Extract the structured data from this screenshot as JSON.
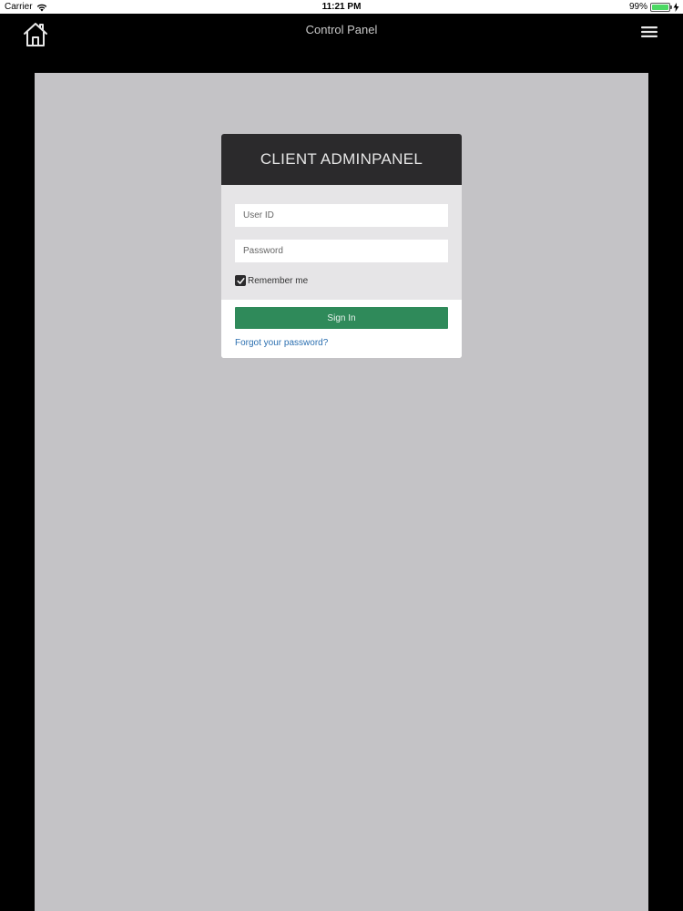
{
  "status_bar": {
    "carrier": "Carrier",
    "time": "11:21 PM",
    "battery_percent": "99%",
    "battery_level": 0.99,
    "wifi_icon": "wifi-icon",
    "charging_icon": "bolt-icon"
  },
  "nav": {
    "title": "Control Panel",
    "home_icon": "home-icon",
    "menu_icon": "hamburger-menu-icon"
  },
  "login": {
    "header": "CLIENT ADMINPANEL",
    "user_id_placeholder": "User ID",
    "user_id_value": "",
    "password_placeholder": "Password",
    "password_value": "",
    "remember_label": "Remember me",
    "remember_checked": true,
    "signin_label": "Sign In",
    "forgot_label": "Forgot your password?"
  },
  "colors": {
    "background": "#000000",
    "content_bg": "#c4c3c6",
    "card_header": "#2b2a2c",
    "card_body": "#e6e5e7",
    "signin_green": "#2f8a5a",
    "link_blue": "#2b6fb0",
    "battery_green": "#4cd964"
  }
}
